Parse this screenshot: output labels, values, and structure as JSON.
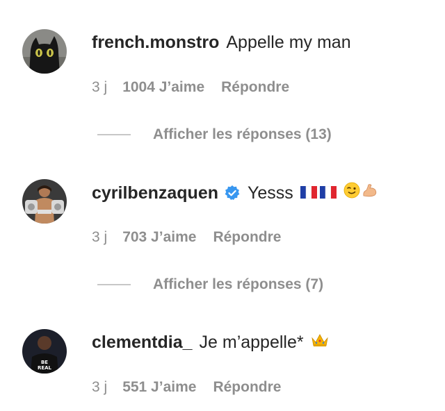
{
  "comments": [
    {
      "username": "french.monstro",
      "text": "Appelle my man",
      "time": "3 j",
      "likes": "1004 J’aime",
      "reply": "Répondre",
      "replies_label": "Afficher les réponses (13)",
      "avatar_icon": "black-cat-photo"
    },
    {
      "username": "cyrilbenzaquen",
      "verified": true,
      "text": "Yesss",
      "time": "3 j",
      "likes": "703 J’aime",
      "reply": "Répondre",
      "replies_label": "Afficher les réponses (7)",
      "avatar_icon": "boxer-with-belts-photo",
      "emojis": [
        "flag-france-icon",
        "flag-france-icon",
        "winking-face-icon",
        "flexed-biceps-icon"
      ]
    },
    {
      "username": "clementdia_",
      "text": "Je m’appelle*",
      "time": "3 j",
      "likes": "551 J’aime",
      "reply": "Répondre",
      "avatar_icon": "man-be-real-shirt-photo",
      "emojis": [
        "crown-icon"
      ]
    }
  ],
  "colors": {
    "text_primary": "#262626",
    "text_secondary": "#8e8e8e",
    "verified_blue": "#3897f0",
    "divider": "#c7c7c7"
  }
}
